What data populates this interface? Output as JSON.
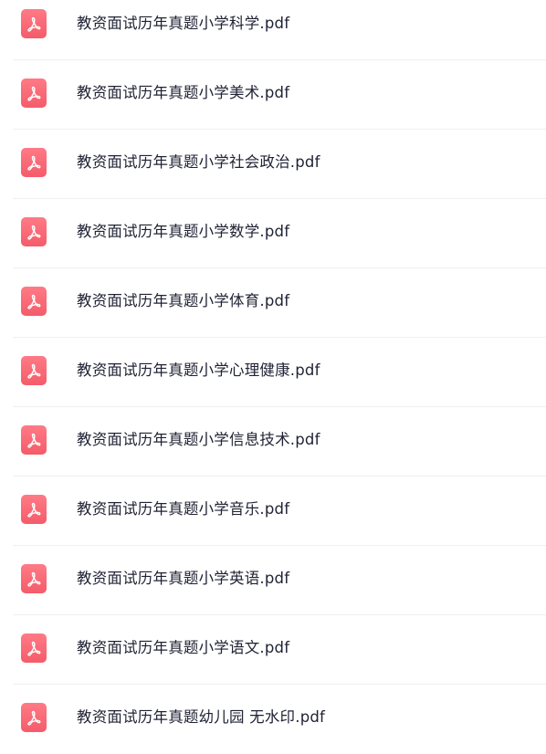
{
  "files": [
    {
      "name": "教资面试历年真题小学科学.pdf",
      "icon": "pdf-file-icon"
    },
    {
      "name": "教资面试历年真题小学美术.pdf",
      "icon": "pdf-file-icon"
    },
    {
      "name": "教资面试历年真题小学社会政治.pdf",
      "icon": "pdf-file-icon"
    },
    {
      "name": "教资面试历年真题小学数学.pdf",
      "icon": "pdf-file-icon"
    },
    {
      "name": "教资面试历年真题小学体育.pdf",
      "icon": "pdf-file-icon"
    },
    {
      "name": "教资面试历年真题小学心理健康.pdf",
      "icon": "pdf-file-icon"
    },
    {
      "name": "教资面试历年真题小学信息技术.pdf",
      "icon": "pdf-file-icon"
    },
    {
      "name": "教资面试历年真题小学音乐.pdf",
      "icon": "pdf-file-icon"
    },
    {
      "name": "教资面试历年真题小学英语.pdf",
      "icon": "pdf-file-icon"
    },
    {
      "name": "教资面试历年真题小学语文.pdf",
      "icon": "pdf-file-icon"
    },
    {
      "name": "教资面试历年真题幼儿园 无水印.pdf",
      "icon": "pdf-file-icon"
    }
  ],
  "colors": {
    "icon_bg": "#f45c6a",
    "text": "#1f2233",
    "divider": "#f0f0f2"
  }
}
